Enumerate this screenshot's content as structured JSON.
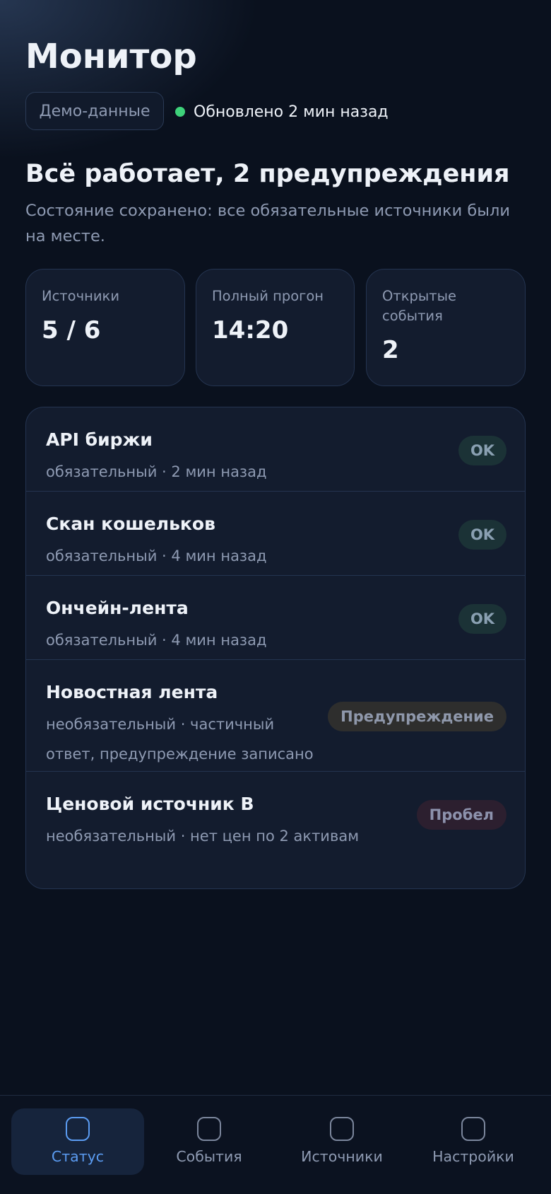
{
  "header": {
    "title": "Монитор",
    "demo_label": "Демо-данные",
    "updated_text": "Обновлено 2 мин назад",
    "updated_dot_color": "#3ed27a"
  },
  "summary": {
    "headline": "Всё работает, 2 предупреждения",
    "description": "Состояние сохранено: все обязательные источники были на месте."
  },
  "stats": [
    {
      "label": "Источники",
      "value": "5 / 6"
    },
    {
      "label": "Полный прогон",
      "value": "14:20"
    },
    {
      "label": "Открытые события",
      "value": "2"
    }
  ],
  "sources": [
    {
      "name": "API биржи",
      "meta": "обязательный · 2 мин назад",
      "status": "OK"
    },
    {
      "name": "Скан кошельков",
      "meta": "обязательный · 4 мин назад",
      "status": "OK"
    },
    {
      "name": "Ончейн-лента",
      "meta": "обязательный · 4 мин назад",
      "status": "OK"
    },
    {
      "name": "Новостная лента",
      "meta": "необязательный · частичный ответ, предупреждение записано",
      "status": "Предупреждение"
    },
    {
      "name": "Ценовой источник B",
      "meta": "необязательный · нет цен по 2 активам",
      "status": "Пробел"
    }
  ],
  "nav": {
    "items": [
      {
        "label": "Статус",
        "icon": "status-icon",
        "active": true
      },
      {
        "label": "События",
        "icon": "events-icon",
        "active": false
      },
      {
        "label": "Источники",
        "icon": "sources-icon",
        "active": false
      },
      {
        "label": "Настройки",
        "icon": "settings-icon",
        "active": false
      }
    ],
    "accent_color": "#5b9cf2"
  }
}
